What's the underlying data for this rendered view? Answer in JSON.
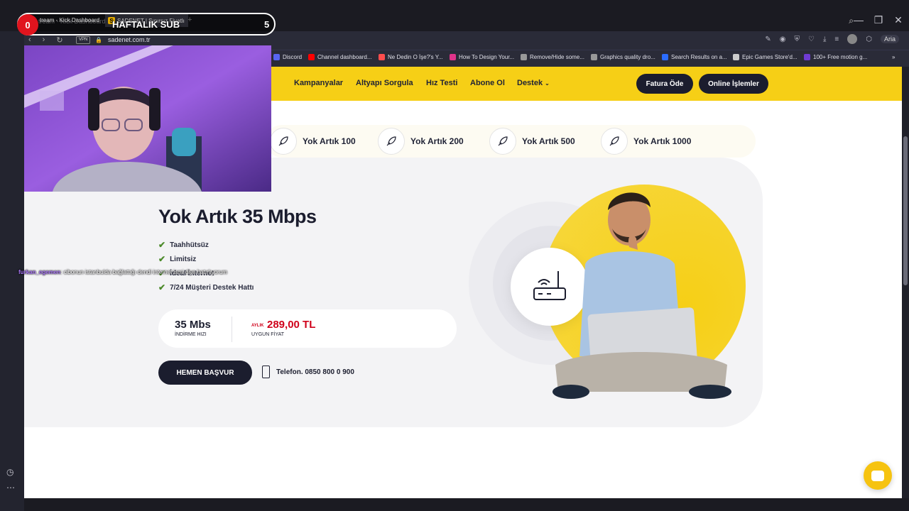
{
  "browser": {
    "tabs": [
      {
        "label": "tream - Kick Dashboard"
      },
      {
        "label": "SADENET | Sınırsız Fiyatlı İnternet"
      }
    ],
    "url": "sadenet.com.tr",
    "vpn_label": "VPN",
    "ai_label": "Aria",
    "bookmarks": [
      {
        "label": "Discord",
        "color": "#5865f2"
      },
      {
        "label": "Channel dashboard...",
        "color": "#ff0000"
      },
      {
        "label": "Ne Dedin O İşe?'s Y...",
        "color": "#ff4d4d"
      },
      {
        "label": "How To Design Your...",
        "color": "#e0338a"
      },
      {
        "label": "Remove/Hide some...",
        "color": "#999999"
      },
      {
        "label": "Graphics quality dro...",
        "color": "#999999"
      },
      {
        "label": "Search Results on a...",
        "color": "#2b6cff"
      },
      {
        "label": "Epic Games Store'd...",
        "color": "#cccccc"
      },
      {
        "label": "100+ Free motion g...",
        "color": "#6f3bd4"
      }
    ]
  },
  "site": {
    "nav": [
      "Kampanyalar",
      "Altyapı Sorgula",
      "Hız Testi",
      "Abone Ol",
      "Destek"
    ],
    "buttons": {
      "pay": "Fatura Öde",
      "online": "Online İşlemler"
    },
    "plans": [
      "Yok Artık 100",
      "Yok Artık 200",
      "Yok Artık 500",
      "Yok Artık 1000"
    ],
    "hero": {
      "title": "Yok Artık 35 Mbps",
      "features": [
        "Taahhütsüz",
        "Limitsiz",
        "İdeal İnternet",
        "7/24 Müşteri Destek Hattı"
      ],
      "speed_value": "35 Mbs",
      "speed_label": "İNDİRME HIZI",
      "price_prefix": "AYLIK",
      "price_value": "289,00 TL",
      "price_label": "UYGUN FİYAT",
      "apply_button": "HEMEN BAŞVUR",
      "phone": "Telefon. 0850 800 0 900"
    },
    "accent": "#f6cf16",
    "dark": "#1b1d2e",
    "price_color": "#d0021b"
  },
  "stream": {
    "sub_count": "0",
    "sub_label": "HAFTALIK SUB",
    "sub_goal": "5",
    "chat": {
      "user": "furkan_egemen",
      "message": ": cibonun istanbulda bağlattığı dendi internet ismi diye hatırlıyorum"
    }
  }
}
